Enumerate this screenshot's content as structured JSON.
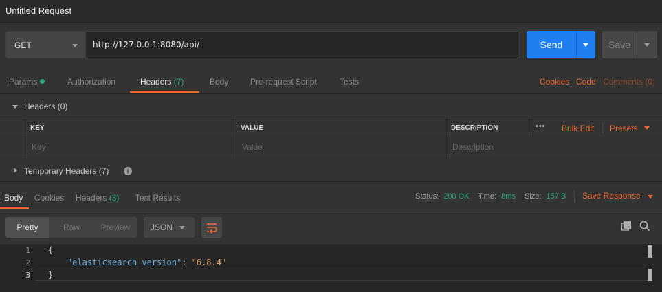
{
  "window": {
    "title": "Untitled Request"
  },
  "request": {
    "method": "GET",
    "url": "http://127.0.0.1:8080/api/",
    "send_label": "Send",
    "save_label": "Save"
  },
  "request_tabs": [
    {
      "label": "Params"
    },
    {
      "label": "Authorization"
    },
    {
      "label": "Headers",
      "count": "(7)"
    },
    {
      "label": "Body"
    },
    {
      "label": "Pre-request Script"
    },
    {
      "label": "Tests"
    }
  ],
  "right_links": {
    "cookies": "Cookies",
    "code": "Code",
    "comments": "Comments (0)"
  },
  "headers_section": {
    "title": "Headers",
    "count": "(0)",
    "columns": {
      "key": "KEY",
      "value": "VALUE",
      "description": "DESCRIPTION"
    },
    "placeholders": {
      "key": "Key",
      "value": "Value",
      "description": "Description"
    },
    "more": "•••",
    "bulk_edit": "Bulk Edit",
    "presets": "Presets"
  },
  "temporary_headers": {
    "title": "Temporary Headers",
    "count": "(7)"
  },
  "response_tabs": [
    {
      "label": "Body"
    },
    {
      "label": "Cookies"
    },
    {
      "label": "Headers",
      "count": "(3)"
    },
    {
      "label": "Test Results"
    }
  ],
  "status": {
    "status_label": "Status:",
    "status_value": "200 OK",
    "time_label": "Time:",
    "time_value": "8ms",
    "size_label": "Size:",
    "size_value": "157 B",
    "save_response": "Save Response"
  },
  "view": {
    "pretty": "Pretty",
    "raw": "Raw",
    "preview": "Preview",
    "format": "JSON"
  },
  "code": {
    "line_numbers": [
      "1",
      "2",
      "3"
    ],
    "open_brace": "{",
    "key": "\"elasticsearch_version\"",
    "colon": ": ",
    "value": "\"6.8.4\"",
    "close_brace": "}"
  },
  "colors": {
    "accent": "#f06a35",
    "send": "#1f7ff0",
    "success": "#28a97f"
  }
}
